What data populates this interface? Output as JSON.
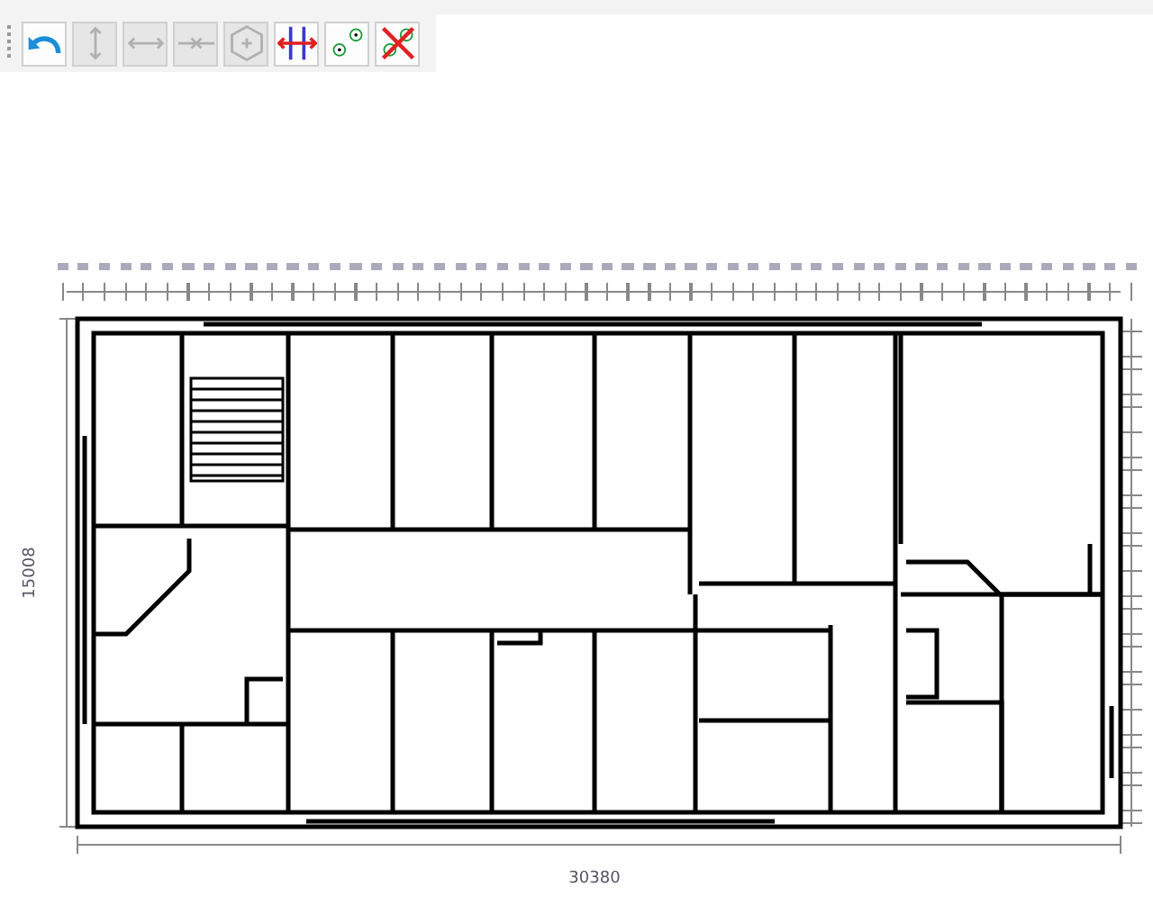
{
  "toolbar": {
    "buttons": [
      {
        "kind": "undo",
        "disabled": false
      },
      {
        "kind": "vertical",
        "disabled": true
      },
      {
        "kind": "horizontal",
        "disabled": true
      },
      {
        "kind": "merge",
        "disabled": true
      },
      {
        "kind": "node",
        "disabled": true
      },
      {
        "kind": "cross",
        "disabled": false
      },
      {
        "kind": "points",
        "disabled": false
      },
      {
        "kind": "clear",
        "disabled": false
      }
    ]
  },
  "plan": {
    "height_label": "15008",
    "width_label": "30380"
  }
}
